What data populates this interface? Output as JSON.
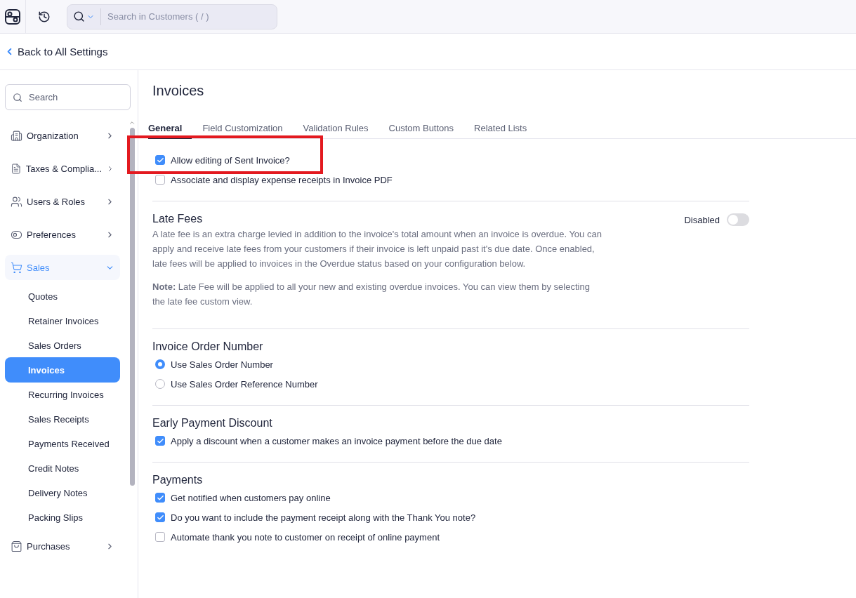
{
  "topbar": {
    "search_placeholder": "Search in Customers ( / )"
  },
  "back_link": "Back to All Settings",
  "sidebar": {
    "search_placeholder": "Search",
    "items": [
      {
        "label": "Organization",
        "expanded": false,
        "selected": false
      },
      {
        "label": "Taxes & Complia...",
        "expanded": false,
        "selected": false
      },
      {
        "label": "Users & Roles",
        "expanded": false,
        "selected": false
      },
      {
        "label": "Preferences",
        "expanded": false,
        "selected": false
      },
      {
        "label": "Sales",
        "expanded": true,
        "selected": true,
        "children": [
          {
            "label": "Quotes",
            "selected": false
          },
          {
            "label": "Retainer Invoices",
            "selected": false
          },
          {
            "label": "Sales Orders",
            "selected": false
          },
          {
            "label": "Invoices",
            "selected": true
          },
          {
            "label": "Recurring Invoices",
            "selected": false
          },
          {
            "label": "Sales Receipts",
            "selected": false
          },
          {
            "label": "Payments Received",
            "selected": false
          },
          {
            "label": "Credit Notes",
            "selected": false
          },
          {
            "label": "Delivery Notes",
            "selected": false
          },
          {
            "label": "Packing Slips",
            "selected": false
          }
        ]
      },
      {
        "label": "Purchases",
        "expanded": false,
        "selected": false
      }
    ]
  },
  "page_title": "Invoices",
  "tabs": [
    {
      "label": "General",
      "selected": true
    },
    {
      "label": "Field Customization",
      "selected": false
    },
    {
      "label": "Validation Rules",
      "selected": false
    },
    {
      "label": "Custom Buttons",
      "selected": false
    },
    {
      "label": "Related Lists",
      "selected": false
    }
  ],
  "sections": [
    {
      "kind": "checks",
      "options": [
        {
          "label": "Allow editing of Sent Invoice?",
          "checked": true,
          "highlighted": true
        },
        {
          "label": "Associate and display expense receipts in Invoice PDF",
          "checked": false,
          "highlighted": false
        }
      ]
    },
    {
      "kind": "toggle",
      "title": "Late Fees",
      "toggle_label": "Disabled",
      "on": false,
      "paragraphs": [
        "A late fee is an extra charge levied in addition to the invoice's total amount when an invoice is overdue. You can apply and receive late fees from your customers if their invoice is left unpaid past it's due date. Once enabled, late fees will be applied to invoices in the Overdue status based on your configuration below.",
        "**Note:** Late Fee will be applied to all your new and existing overdue invoices. You can view them by selecting the late fee custom view."
      ]
    },
    {
      "kind": "radios",
      "title": "Invoice Order Number",
      "options": [
        {
          "label": "Use Sales Order Number",
          "selected": true
        },
        {
          "label": "Use Sales Order Reference Number",
          "selected": false
        }
      ]
    },
    {
      "kind": "checks",
      "title": "Early Payment Discount",
      "options": [
        {
          "label": "Apply a discount when a customer makes an invoice payment before the due date",
          "checked": true,
          "highlighted": false
        }
      ]
    },
    {
      "kind": "checks",
      "title": "Payments",
      "options": [
        {
          "label": "Get notified when customers pay online",
          "checked": true,
          "highlighted": false
        },
        {
          "label": "Do you want to include the payment receipt along with the Thank You note?",
          "checked": true,
          "highlighted": false
        },
        {
          "label": "Automate thank you note to customer on receipt of online payment",
          "checked": false,
          "highlighted": false
        }
      ]
    }
  ]
}
